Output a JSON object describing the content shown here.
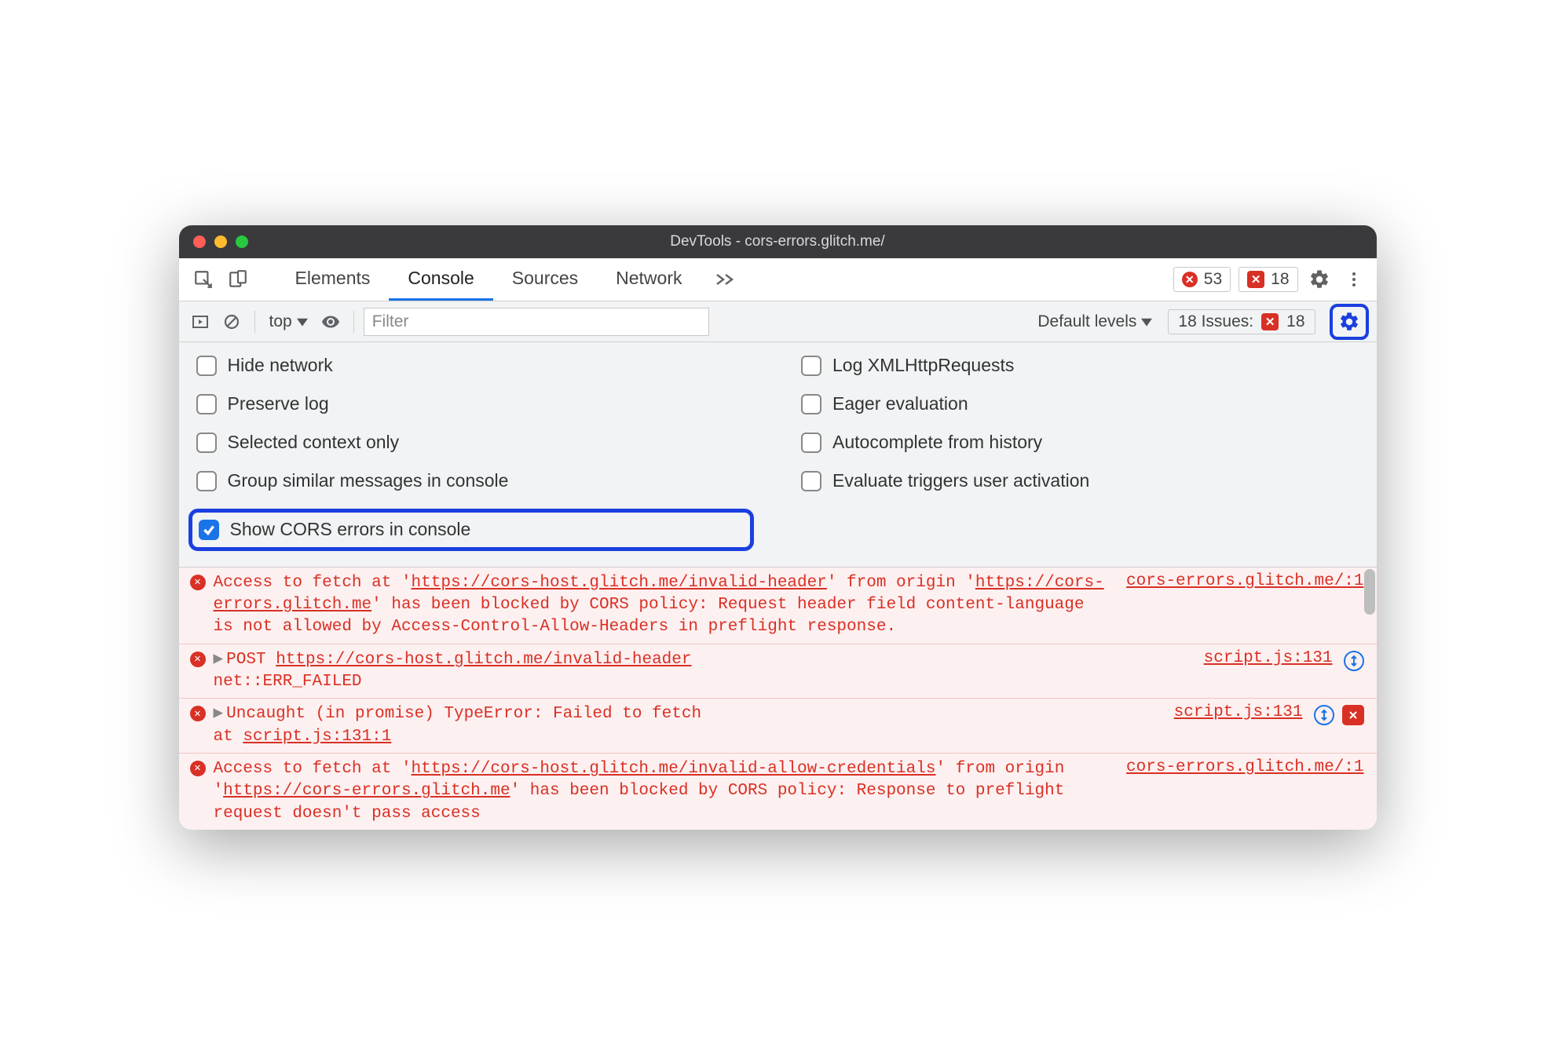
{
  "titlebar": {
    "title": "DevTools - cors-errors.glitch.me/"
  },
  "tabstrip": {
    "tabs": [
      "Elements",
      "Console",
      "Sources",
      "Network"
    ],
    "active_index": 1,
    "errors_count": "53",
    "issues_count": "18"
  },
  "console_toolbar": {
    "context_label": "top",
    "filter_placeholder": "Filter",
    "levels_label": "Default levels",
    "issues_label": "18 Issues:",
    "issues_badge": "18"
  },
  "settings": {
    "left": [
      {
        "label": "Hide network",
        "checked": false
      },
      {
        "label": "Preserve log",
        "checked": false
      },
      {
        "label": "Selected context only",
        "checked": false
      },
      {
        "label": "Group similar messages in console",
        "checked": false
      },
      {
        "label": "Show CORS errors in console",
        "checked": true,
        "highlight": true
      }
    ],
    "right": [
      {
        "label": "Log XMLHttpRequests",
        "checked": false
      },
      {
        "label": "Eager evaluation",
        "checked": false
      },
      {
        "label": "Autocomplete from history",
        "checked": false
      },
      {
        "label": "Evaluate triggers user activation",
        "checked": false
      }
    ]
  },
  "logs": [
    {
      "type": "error",
      "src": "cors-errors.glitch.me/:1",
      "text_pre": "Access to fetch at '",
      "url1": "https://cors-host.glitch.me/invalid-header",
      "text_mid": "' from origin '",
      "url2": "https://cors-errors.glitch.me",
      "text_post": "' has been blocked by CORS policy: Request header field content-language is not allowed by Access-Control-Allow-Headers in preflight response."
    },
    {
      "type": "error",
      "src": "script.js:131",
      "method": "POST",
      "url": "https://cors-host.glitch.me/invalid-header",
      "tail": "net::ERR_FAILED",
      "expandable": true,
      "net_icon": true
    },
    {
      "type": "error",
      "src": "script.js:131",
      "line1": "Uncaught (in promise) TypeError: Failed to fetch",
      "line2_pre": "    at ",
      "line2_link": "script.js:131:1",
      "expandable": true,
      "net_icon": true,
      "issue_badge": true
    },
    {
      "type": "error",
      "src": "cors-errors.glitch.me/:1",
      "text_pre": "Access to fetch at '",
      "url1": "https://cors-host.glitch.me/invalid-allow-credentials",
      "text_mid": "' from origin '",
      "url2": "https://cors-errors.glitch.me",
      "text_post": "' has been blocked by CORS policy: Response to preflight request doesn't pass access"
    }
  ]
}
